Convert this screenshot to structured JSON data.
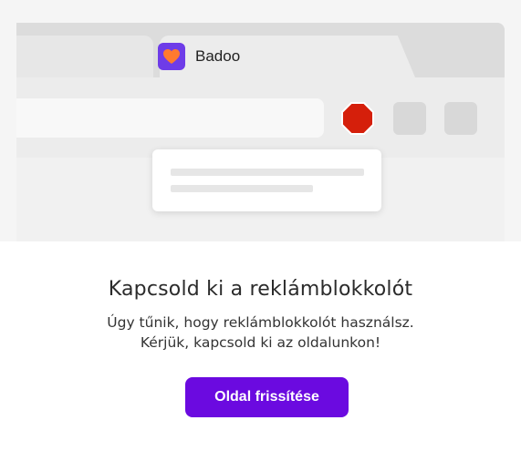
{
  "browser_illustration": {
    "tab_title": "Badoo",
    "logo_icon": "heart-logo-icon",
    "blocker_icon": "stop-octagon-icon",
    "colors": {
      "logo_bg": "#6e3ce8",
      "logo_heart": "#ff7a2f",
      "stop_sign": "#d51f0b"
    }
  },
  "message": {
    "title": "Kapcsold ki a reklámblokkolót",
    "line1": "Úgy tűnik, hogy reklámblokkolót használsz.",
    "line2": "Kérjük, kapcsold ki az oldalunkon!"
  },
  "actions": {
    "refresh_label": "Oldal frissítése",
    "button_color": "#6b0ae0"
  }
}
